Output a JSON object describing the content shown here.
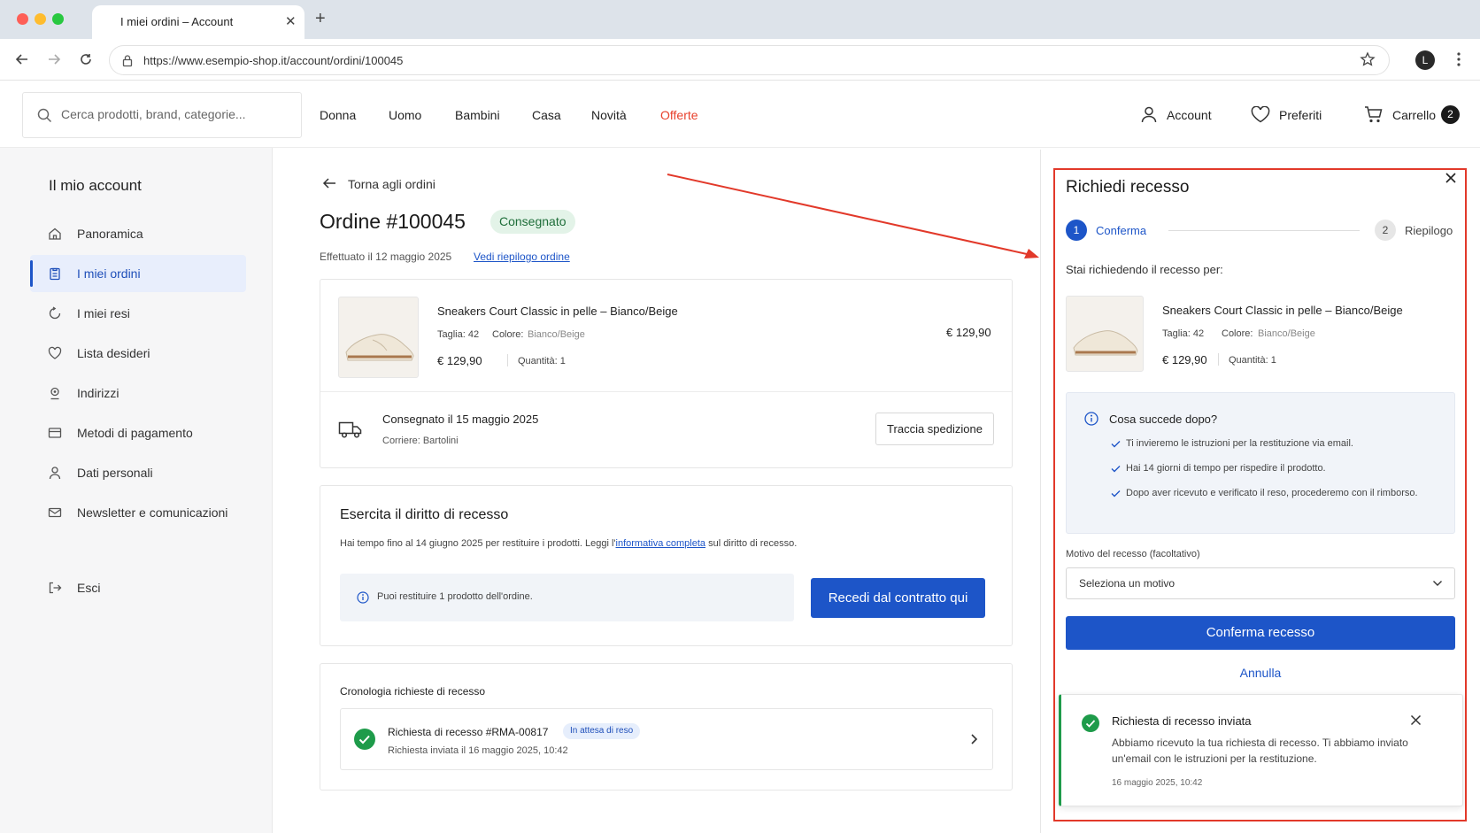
{
  "browser": {
    "tab_title": "I miei ordini – Account",
    "url": "https://www.esempio-shop.it/account/ordini/100045",
    "profile_initial": "L"
  },
  "header": {
    "search_placeholder": "Cerca prodotti, brand, categorie...",
    "nav": [
      "Donna",
      "Uomo",
      "Bambini",
      "Casa",
      "Novità",
      "Offerte"
    ],
    "account_label": "Account",
    "favorites_label": "Preferiti",
    "cart_label": "Carrello",
    "cart_count": "2"
  },
  "sidebar": {
    "title": "Il mio account",
    "items": [
      {
        "label": "Panoramica",
        "icon": "home-icon"
      },
      {
        "label": "I miei ordini",
        "icon": "clipboard-icon",
        "active": true
      },
      {
        "label": "I miei resi",
        "icon": "return-icon"
      },
      {
        "label": "Lista desideri",
        "icon": "heart-icon"
      },
      {
        "label": "Indirizzi",
        "icon": "map-pin-icon"
      },
      {
        "label": "Metodi di pagamento",
        "icon": "credit-card-icon"
      },
      {
        "label": "Dati personali",
        "icon": "user-icon"
      },
      {
        "label": "Newsletter e comunicazioni",
        "icon": "mail-icon"
      }
    ],
    "logout_label": "Esci"
  },
  "order": {
    "back_label": "Torna agli ordini",
    "title": "Ordine #100045",
    "status": "Consegnato",
    "placed": "Effettuato il 12 maggio 2025",
    "summary_link": "Vedi riepilogo ordine",
    "product": {
      "name": "Sneakers Court Classic in pelle – Bianco/Beige",
      "size_label": "Taglia: 42",
      "color_label": "Colore:",
      "color_value": "Bianco/Beige",
      "price": "€ 129,90",
      "qty": "Quantità: 1",
      "total": "€ 129,90"
    },
    "delivery": {
      "title": "Consegnato il 15 maggio 2025",
      "carrier": "Corriere: Bartolini",
      "track_button": "Traccia spedizione"
    }
  },
  "withdrawal": {
    "title": "Esercita il diritto di recesso",
    "text_before": "Hai tempo fino al 14 giugno 2025 per restituire i prodotti. Leggi l'",
    "link": "informativa completa",
    "text_after": " sul diritto di recesso.",
    "info": "Puoi restituire 1 prodotto dell'ordine.",
    "button": "Recedi dal contratto qui"
  },
  "history": {
    "title": "Cronologia richieste di recesso",
    "item_title": "Richiesta di recesso #RMA-00817",
    "item_badge": "In attesa di reso",
    "item_date": "Richiesta inviata il 16 maggio 2025, 10:42"
  },
  "panel": {
    "title": "Richiedi recesso",
    "steps": [
      {
        "num": "1",
        "label": "Conferma"
      },
      {
        "num": "2",
        "label": "Riepilogo"
      }
    ],
    "intro": "Stai richiedendo il recesso per:",
    "product": {
      "name": "Sneakers Court Classic in pelle – Bianco/Beige",
      "size_label": "Taglia: 42",
      "color_label": "Colore:",
      "color_value": "Bianco/Beige",
      "price": "€ 129,90",
      "qty": "Quantità: 1"
    },
    "next": {
      "title": "Cosa succede dopo?",
      "items": [
        "Ti invieremo le istruzioni per la restituzione via email.",
        "Hai 14 giorni di tempo per rispedire il prodotto.",
        "Dopo aver ricevuto e verificato il reso, procederemo con il rimborso."
      ]
    },
    "reason_label": "Motivo del recesso (facoltativo)",
    "reason_selected": "Seleziona un motivo",
    "confirm_button": "Conferma recesso",
    "cancel_button": "Annulla",
    "toast": {
      "title": "Richiesta di recesso inviata",
      "text": "Abbiamo ricevuto la tua richiesta di recesso. Ti abbiamo inviato un'email con le istruzioni per la restituzione.",
      "time": "16 maggio 2025, 10:42"
    }
  },
  "colors": {
    "accent": "#1d55c8",
    "offer": "#e8412c",
    "success": "#1e9b4a",
    "annotation": "#e2392a"
  }
}
